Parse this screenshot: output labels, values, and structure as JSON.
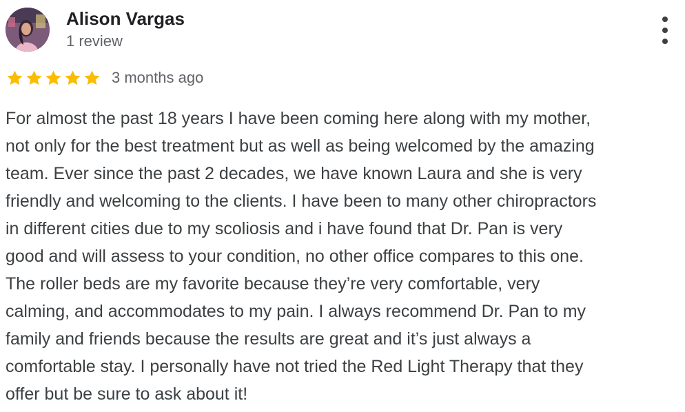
{
  "review": {
    "author_name": "Alison Vargas",
    "author_meta": "1 review",
    "rating": 5,
    "rating_max": 5,
    "date": "3 months ago",
    "star_color": "#fbbc04",
    "text_lines": [
      "For almost the past 18 years I have been coming here along with my mother,",
      "not only for the best treatment but as well as being welcomed by the amazing",
      "team. Ever since the past 2 decades, we have known Laura and she is very",
      "friendly and welcoming to the clients. I have been to many other chiropractors",
      "in different cities due to my scoliosis and i have found that Dr. Pan is very",
      "good and will assess to your condition, no other office compares to this one.",
      "The roller beds are my favorite because they’re very comfortable, very",
      "calming, and accommodates to my pain. I always recommend Dr. Pan to my",
      "family and friends because the results are great and it’s just always a",
      "comfortable stay. I personally have not tried the Red Light Therapy that they",
      "offer but be sure to ask about it!"
    ]
  },
  "icons": {
    "avatar": "user-avatar-photo",
    "more": "more-vert-icon",
    "star": "star-icon"
  }
}
